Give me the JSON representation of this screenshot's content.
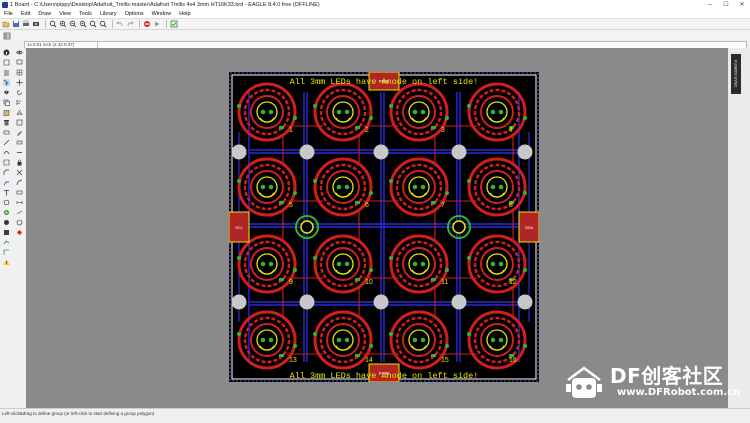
{
  "window": {
    "title": "1 Board - C:\\Users\\pippy\\Desktop\\Adafruit_Trellis-master\\Adafruit Trellis 4x4 3mm HT16K33.brd - EAGLE 8.4.0 free (OFFLINE)",
    "minimize": "–",
    "maximize": "☐",
    "close": "✕"
  },
  "menu": [
    "File",
    "Edit",
    "Draw",
    "View",
    "Tools",
    "Library",
    "Options",
    "Window",
    "Help"
  ],
  "toolbar_icons": [
    "open-icon",
    "save-icon",
    "print-icon",
    "cam-icon",
    "sep",
    "zoom-fit-icon",
    "zoom-in-icon",
    "zoom-out-icon",
    "zoom-redraw-icon",
    "zoom-select-icon",
    "zoom-area-icon",
    "sep",
    "undo-icon",
    "redo-icon",
    "sep",
    "stop-icon",
    "go-icon",
    "sep",
    "drc-icon"
  ],
  "coord_readout": "1x 0.01 inch (2.42 0.37)",
  "status_message": "Left-click&drag to define group (or left-click to start defining a group polygon)",
  "right_panel": {
    "fusion_label": "FUSION SYNC"
  },
  "board": {
    "top_text": "All 3mm LEDs have Anode on left side!",
    "bottom_text": "All 3mm LEDs have Anode on left side!",
    "top_tab": "PWR",
    "bottom_tab": "PWR",
    "left_tab": "SCL",
    "right_tab": "SDA",
    "pad_numbers": [
      "1",
      "2",
      "3",
      "4",
      "5",
      "6",
      "7",
      "8",
      "9",
      "10",
      "11",
      "12",
      "13",
      "14",
      "15",
      "16"
    ],
    "colors": {
      "background": "#000000",
      "bottom_copper": "#2a2adc",
      "top_copper": "#d21e1e",
      "silk": "#e6e600",
      "pads": "#2fb52f",
      "holes": "#c8c8c8",
      "outline": "#ffffff"
    }
  },
  "watermark": {
    "brand": "DF创客社区",
    "url": "www.DFRobot.com.cn"
  }
}
